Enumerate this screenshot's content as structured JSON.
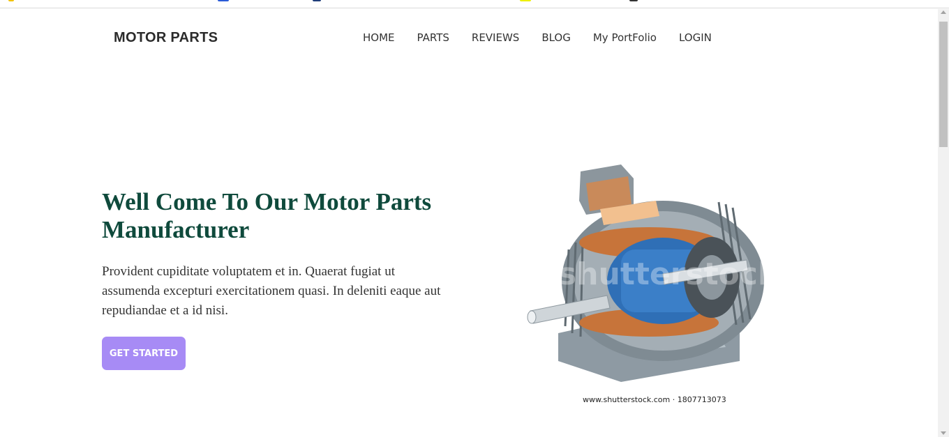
{
  "navbar": {
    "brand": "MOTOR PARTS",
    "links": [
      "HOME",
      "PARTS",
      "REVIEWS",
      "BLOG",
      "My PortFolio",
      "LOGIN"
    ]
  },
  "hero": {
    "title": "Well Come To Our Motor Parts Manufacturer",
    "text": "Provident cupiditate voluptatem et in. Quaerat fugiat ut assumenda excepturi exercitationem quasi. In deleniti eaque aut repudiandae et a id nisi.",
    "cta_label": "GET STARTED",
    "image_watermark": "shutterstock",
    "image_caption": "www.shutterstock.com · 1807713073"
  },
  "colors": {
    "title": "#0f4a3c",
    "cta_bg": "#a78bf5",
    "text": "#333333"
  }
}
